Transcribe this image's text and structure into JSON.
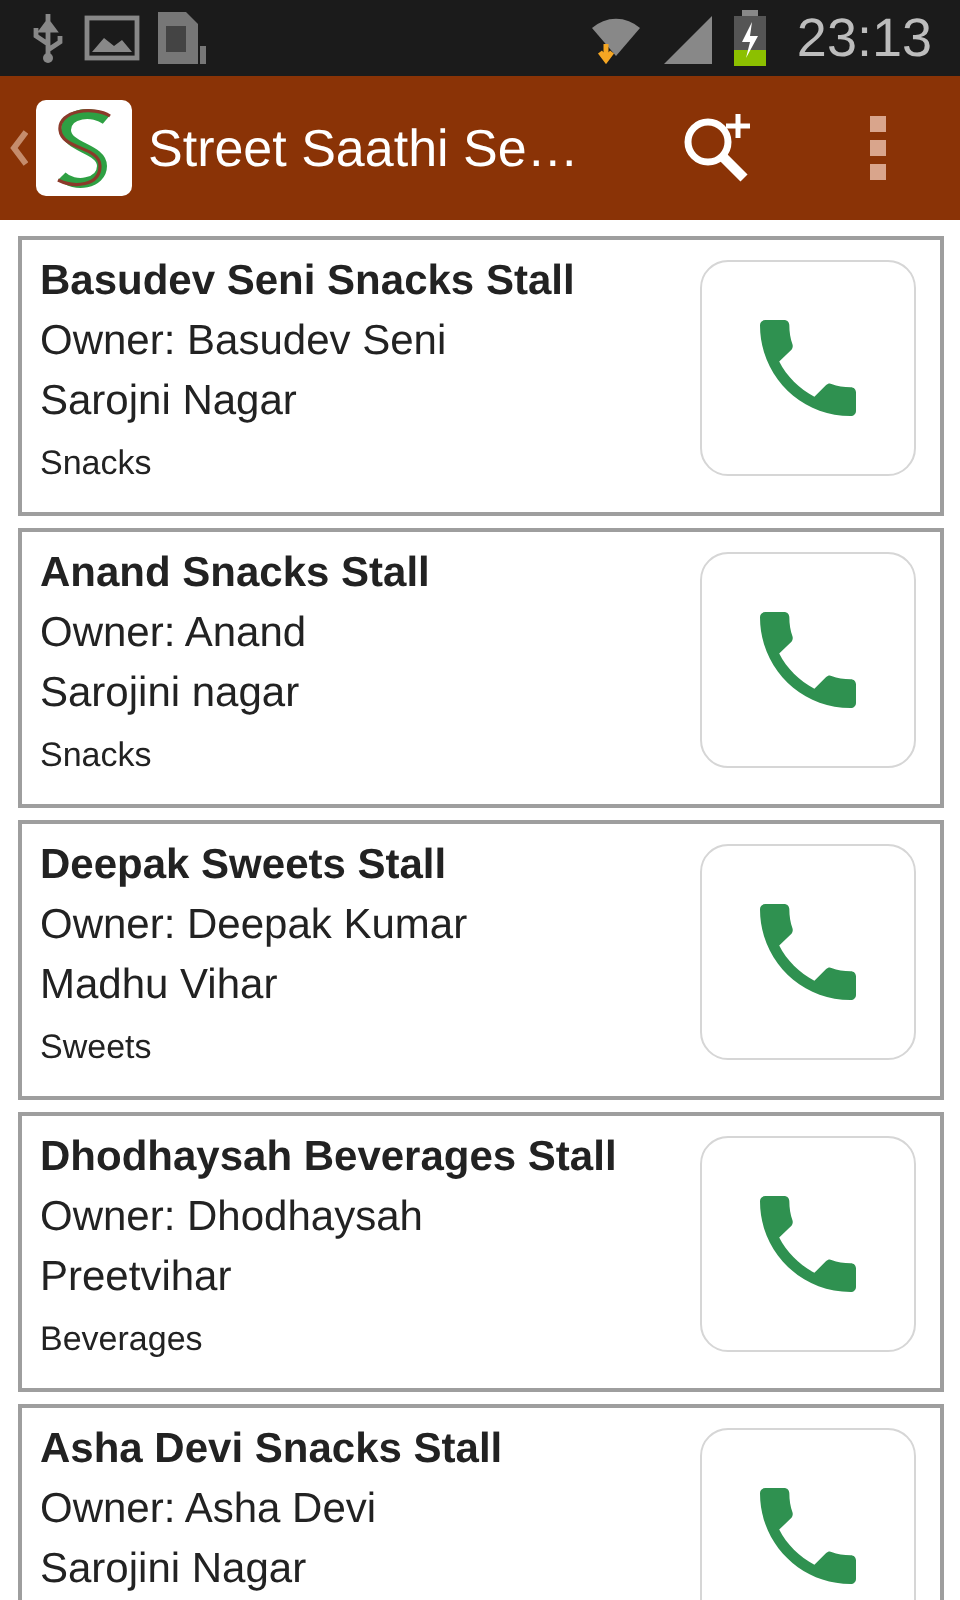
{
  "status_bar": {
    "time": "23:13"
  },
  "action_bar": {
    "title": "Street Saathi Se…"
  },
  "stalls": [
    {
      "name": "Basudev Seni Snacks Stall",
      "owner": "Owner: Basudev Seni",
      "area": "Sarojni Nagar",
      "category": "Snacks"
    },
    {
      "name": "Anand Snacks Stall",
      "owner": "Owner: Anand",
      "area": "Sarojini nagar",
      "category": "Snacks"
    },
    {
      "name": "Deepak Sweets Stall",
      "owner": "Owner: Deepak Kumar",
      "area": "Madhu Vihar",
      "category": "Sweets"
    },
    {
      "name": "Dhodhaysah Beverages Stall",
      "owner": "Owner: Dhodhaysah",
      "area": "Preetvihar",
      "category": "Beverages"
    },
    {
      "name": "Asha Devi Snacks Stall",
      "owner": "Owner: Asha Devi",
      "area": "Sarojini Nagar"
    }
  ]
}
